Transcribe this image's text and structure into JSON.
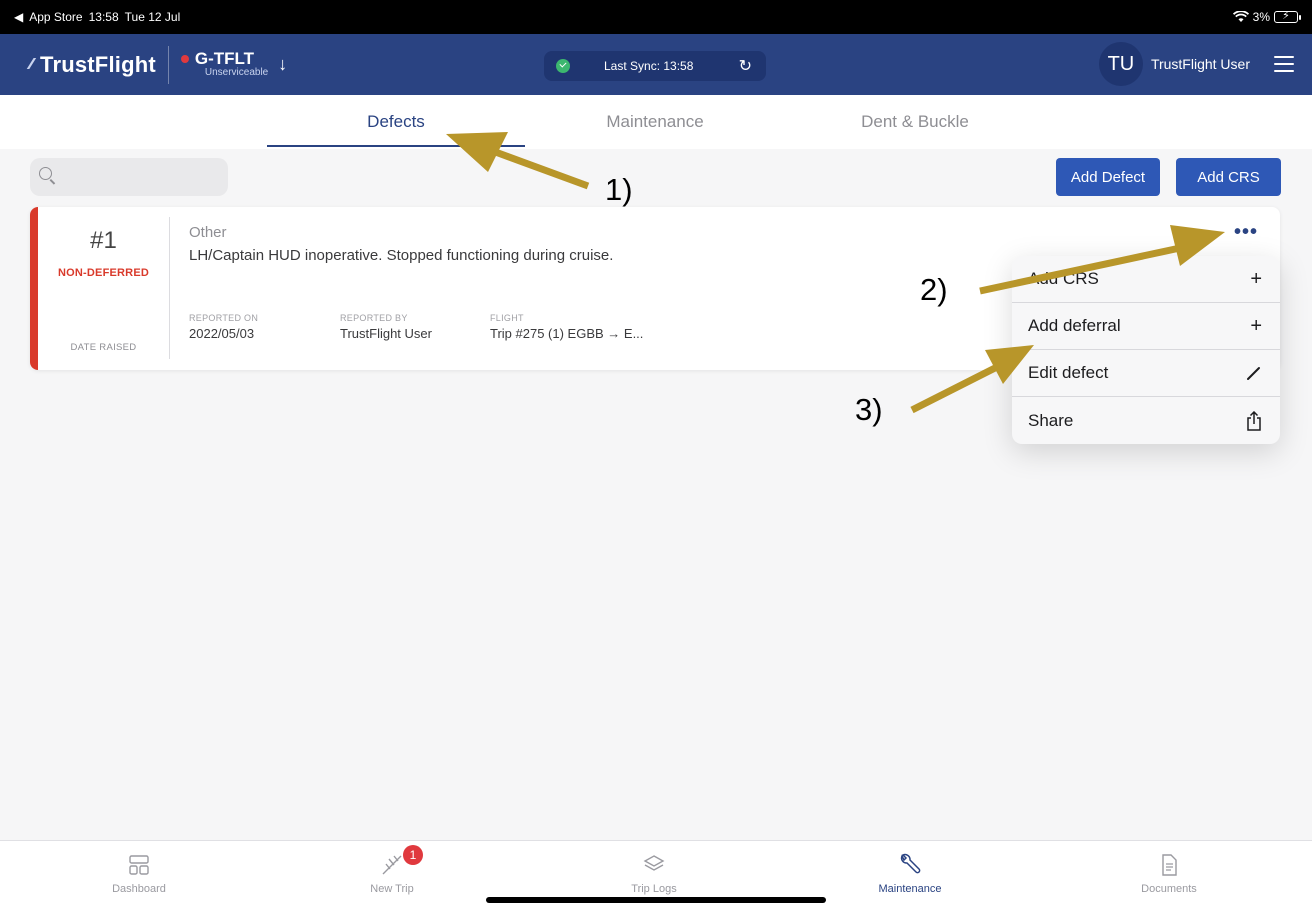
{
  "status_bar": {
    "back_label": "App Store",
    "time": "13:58",
    "date": "Tue 12 Jul",
    "battery": "3%"
  },
  "header": {
    "brand": "TrustFlight",
    "aircraft_reg": "G-TFLT",
    "aircraft_status": "Unserviceable",
    "sync_text": "Last Sync: 13:58",
    "user_initials": "TU",
    "user_name": "TrustFlight User"
  },
  "tabs": [
    {
      "label": "Defects",
      "active": true
    },
    {
      "label": "Maintenance",
      "active": false
    },
    {
      "label": "Dent & Buckle",
      "active": false
    }
  ],
  "toolbar": {
    "search_placeholder": "",
    "add_defect_label": "Add Defect",
    "add_crs_label": "Add CRS"
  },
  "defect": {
    "number": "#1",
    "deferral_status": "NON-DEFERRED",
    "date_raised_label": "DATE RAISED",
    "category": "Other",
    "description": "LH/Captain HUD inoperative. Stopped functioning during cruise.",
    "reported_on_label": "REPORTED ON",
    "reported_on": "2022/05/03",
    "reported_by_label": "REPORTED BY",
    "reported_by": "TrustFlight User",
    "flight_label": "FLIGHT",
    "flight": "Trip #275 (1) EGBB → E..."
  },
  "menu": {
    "items": [
      {
        "label": "Add CRS",
        "icon": "plus-icon"
      },
      {
        "label": "Add deferral",
        "icon": "plus-icon"
      },
      {
        "label": "Edit defect",
        "icon": "pencil-icon"
      },
      {
        "label": "Share",
        "icon": "share-icon"
      }
    ]
  },
  "annotations": {
    "label_1": "1)",
    "label_2": "2)",
    "label_3": "3)",
    "arrow_color": "#b8962a"
  },
  "bottom_nav": [
    {
      "label": "Dashboard",
      "icon": "dashboard-icon",
      "active": false
    },
    {
      "label": "New Trip",
      "icon": "new-trip-icon",
      "active": false,
      "badge": "1"
    },
    {
      "label": "Trip Logs",
      "icon": "trip-logs-icon",
      "active": false
    },
    {
      "label": "Maintenance",
      "icon": "maintenance-icon",
      "active": true
    },
    {
      "label": "Documents",
      "icon": "documents-icon",
      "active": false
    }
  ],
  "colors": {
    "header_bg": "#2a4382",
    "primary_button": "#2e58b6",
    "alert_red": "#d93a2b"
  }
}
